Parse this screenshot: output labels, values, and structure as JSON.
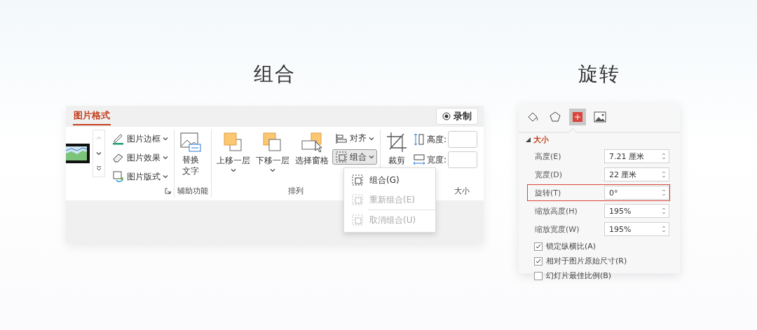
{
  "grouping": {
    "heading": "组合",
    "ribbon": {
      "tabs": [
        {
          "label": "图片格式",
          "selected": true
        }
      ],
      "record_button": "录制",
      "style_buttons": [
        {
          "kind": "border",
          "label": "图片边框"
        },
        {
          "kind": "effect",
          "label": "图片效果"
        },
        {
          "kind": "layout",
          "label": "图片版式"
        }
      ],
      "alt_text_button": "替换文字",
      "arrange_buttons": [
        {
          "kind": "forward",
          "label": "上移一层"
        },
        {
          "kind": "backward",
          "label": "下移一层"
        },
        {
          "kind": "pane",
          "label": "选择窗格"
        }
      ],
      "small_buttons": [
        {
          "kind": "align",
          "label": "对齐",
          "pressed": false
        },
        {
          "kind": "group",
          "label": "组合",
          "pressed": true
        }
      ],
      "crop_button": "裁剪",
      "size_fields": [
        {
          "kind": "height",
          "label": "高度:"
        },
        {
          "kind": "width",
          "label": "宽度:"
        }
      ],
      "group_labels": [
        "辅助功能",
        "排列",
        "大小"
      ],
      "menu": [
        {
          "label": "组合(G)",
          "disabled": false
        },
        {
          "label": "重新组合(E)",
          "disabled": true
        },
        {
          "label": "取消组合(U)",
          "disabled": true
        }
      ]
    }
  },
  "rotation": {
    "heading": "旋转",
    "panel": {
      "tabs": [
        {
          "kind": "fill",
          "selected": false
        },
        {
          "kind": "shape",
          "selected": false
        },
        {
          "kind": "size",
          "selected": true
        },
        {
          "kind": "picture",
          "selected": false
        }
      ],
      "section": {
        "title": "大小",
        "expanded": true
      },
      "fields": [
        {
          "label": "高度(E)",
          "value": "7.21 厘米",
          "highlighted": false
        },
        {
          "label": "宽度(D)",
          "value": "22 厘米",
          "highlighted": false
        },
        {
          "label": "旋转(T)",
          "value": "0°",
          "highlighted": true
        },
        {
          "label": "缩放高度(H)",
          "value": "195%",
          "highlighted": false
        },
        {
          "label": "缩放宽度(W)",
          "value": "195%",
          "highlighted": false
        }
      ],
      "checkboxes": [
        {
          "label": "锁定纵横比(A)",
          "checked": true
        },
        {
          "label": "相对于图片原始尺寸(R)",
          "checked": true
        },
        {
          "label": "幻灯片最佳比例(B)",
          "checked": false
        }
      ]
    }
  }
}
